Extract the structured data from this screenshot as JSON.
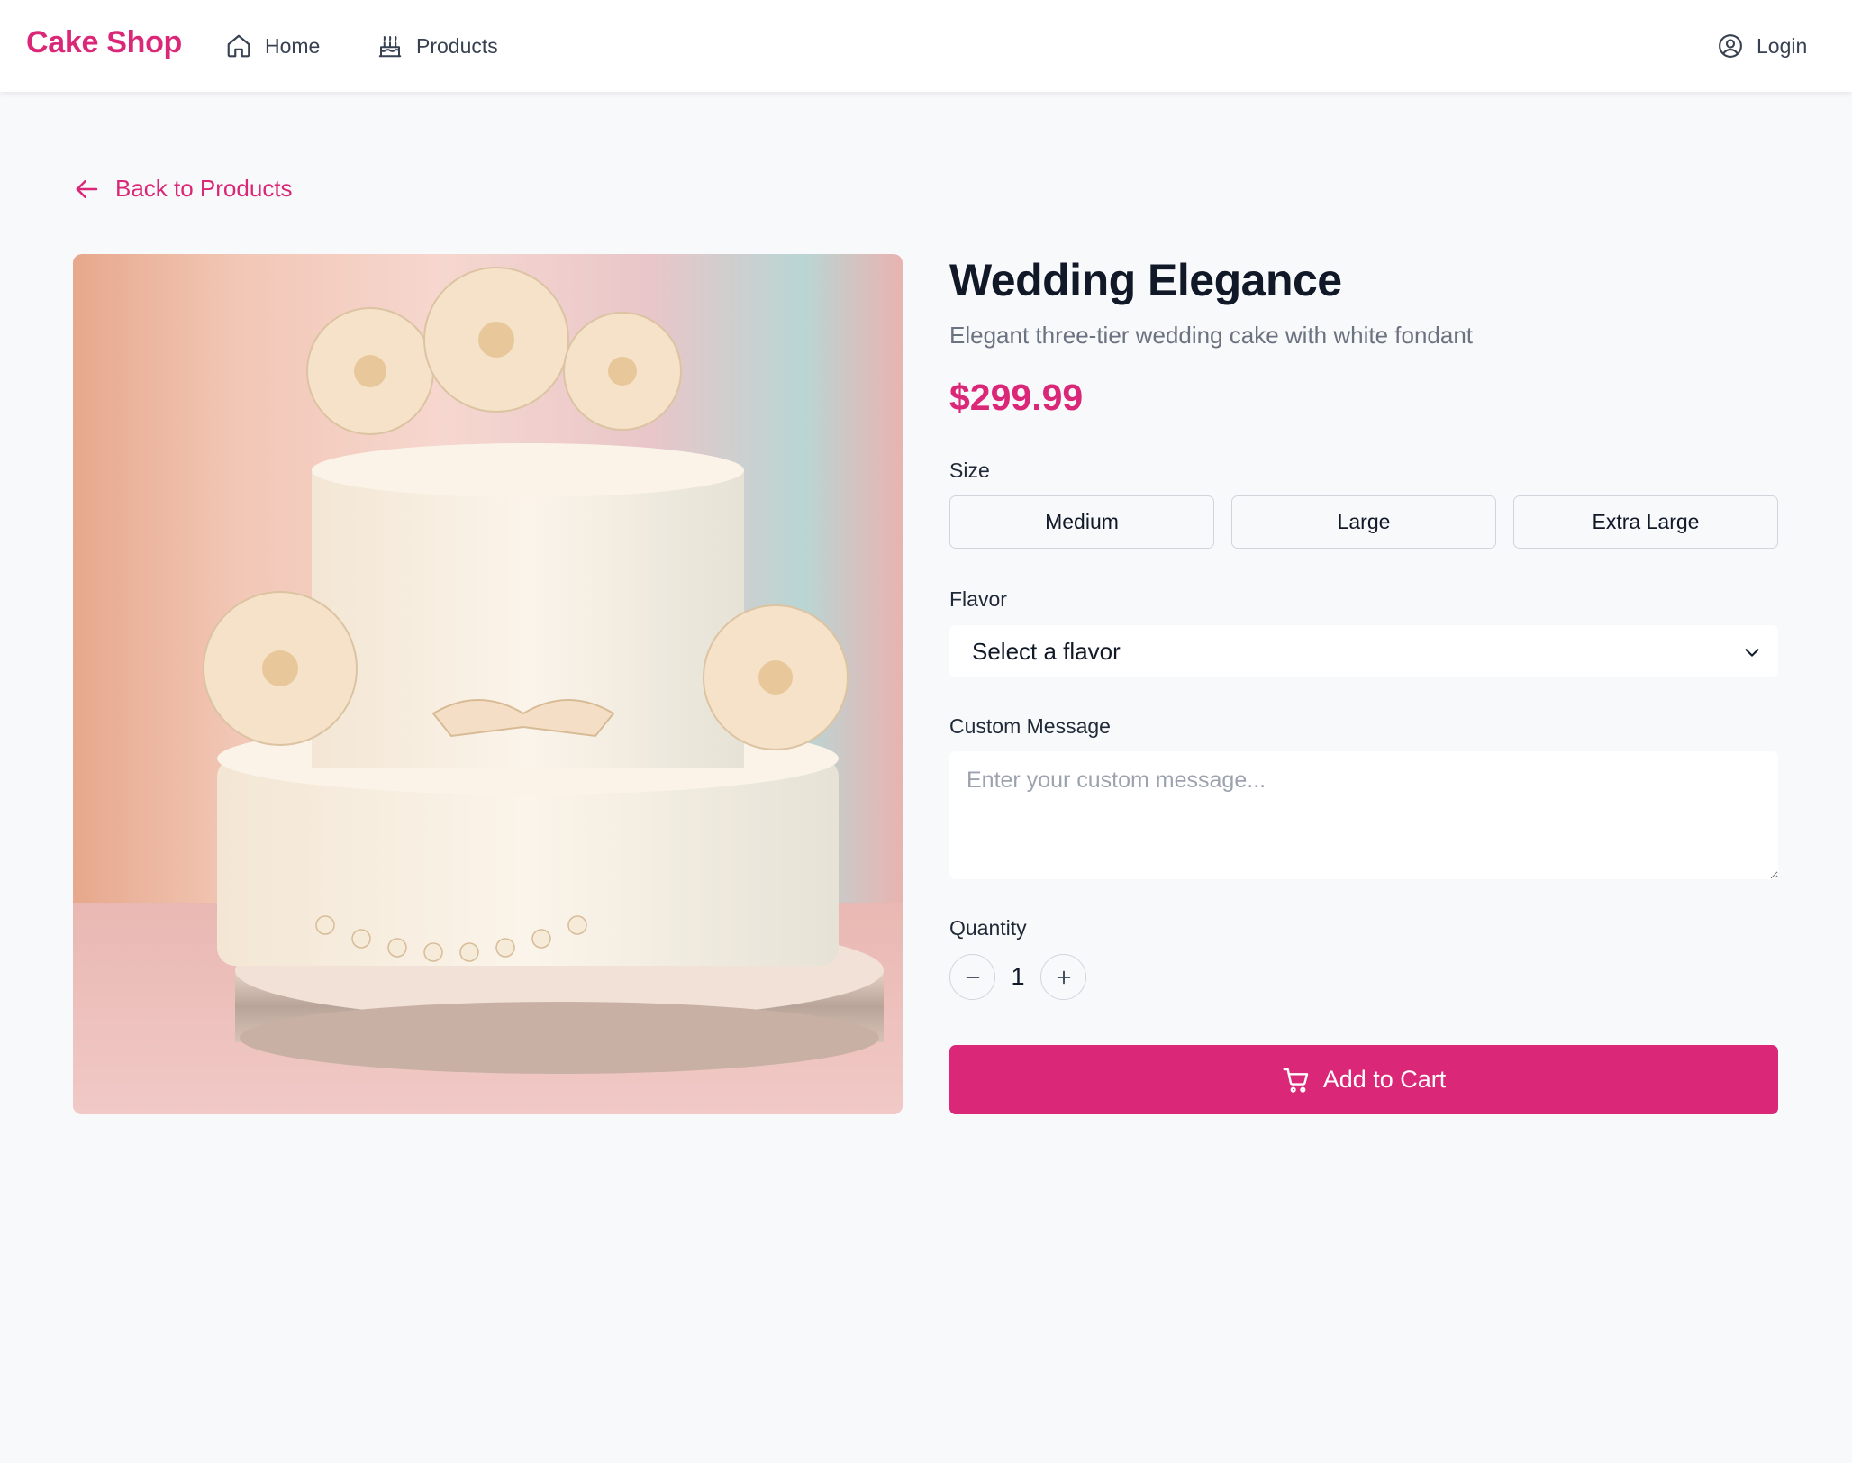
{
  "header": {
    "brand": "Cake Shop",
    "nav": [
      {
        "label": "Home",
        "icon": "home-icon"
      },
      {
        "label": "Products",
        "icon": "cake-icon"
      }
    ],
    "login_label": "Login"
  },
  "back_link": "Back to Products",
  "product": {
    "title": "Wedding Elegance",
    "description": "Elegant three-tier wedding cake with white fondant",
    "price": "$299.99"
  },
  "options": {
    "size_label": "Size",
    "sizes": [
      "Medium",
      "Large",
      "Extra Large"
    ],
    "flavor_label": "Flavor",
    "flavor_selected": "Select a flavor",
    "message_label": "Custom Message",
    "message_placeholder": "Enter your custom message...",
    "quantity_label": "Quantity",
    "quantity": "1"
  },
  "cart_button": "Add to Cart",
  "colors": {
    "accent": "#db2777",
    "background": "#f8f9fb"
  }
}
